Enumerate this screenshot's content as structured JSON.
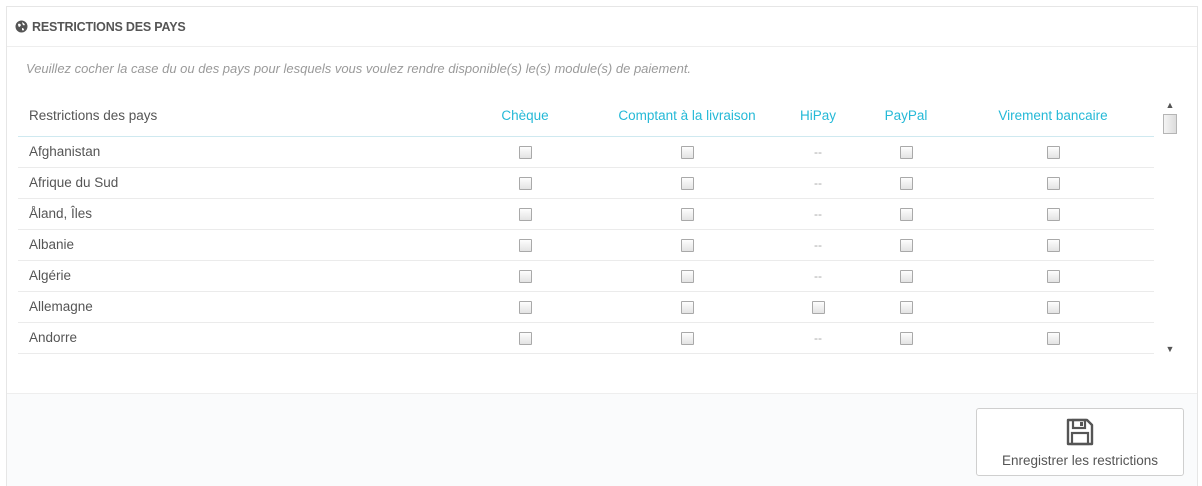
{
  "panel": {
    "title": "RESTRICTIONS DES PAYS",
    "help_text": "Veuillez cocher la case du ou des pays pour lesquels vous voulez rendre disponible(s) le(s) module(s) de paiement."
  },
  "table": {
    "headers": [
      "Restrictions des pays",
      "Chèque",
      "Comptant à la livraison",
      "HiPay",
      "PayPal",
      "Virement bancaire"
    ],
    "rows": [
      {
        "country": "Afghanistan",
        "cells": [
          "cb",
          "cb",
          "--",
          "cb",
          "cb"
        ]
      },
      {
        "country": "Afrique du Sud",
        "cells": [
          "cb",
          "cb",
          "--",
          "cb",
          "cb"
        ]
      },
      {
        "country": "Åland, Îles",
        "cells": [
          "cb",
          "cb",
          "--",
          "cb",
          "cb"
        ]
      },
      {
        "country": "Albanie",
        "cells": [
          "cb",
          "cb",
          "--",
          "cb",
          "cb"
        ]
      },
      {
        "country": "Algérie",
        "cells": [
          "cb",
          "cb",
          "--",
          "cb",
          "cb"
        ]
      },
      {
        "country": "Allemagne",
        "cells": [
          "cb",
          "cb",
          "cb",
          "cb",
          "cb"
        ]
      },
      {
        "country": "Andorre",
        "cells": [
          "cb",
          "cb",
          "--",
          "cb",
          "cb"
        ]
      }
    ]
  },
  "footer": {
    "save_label": "Enregistrer les restrictions",
    "save_icon": "floppy-disk-icon"
  },
  "colors": {
    "accent": "#25b9d7",
    "text": "#555555",
    "muted": "#9a9a9a"
  }
}
